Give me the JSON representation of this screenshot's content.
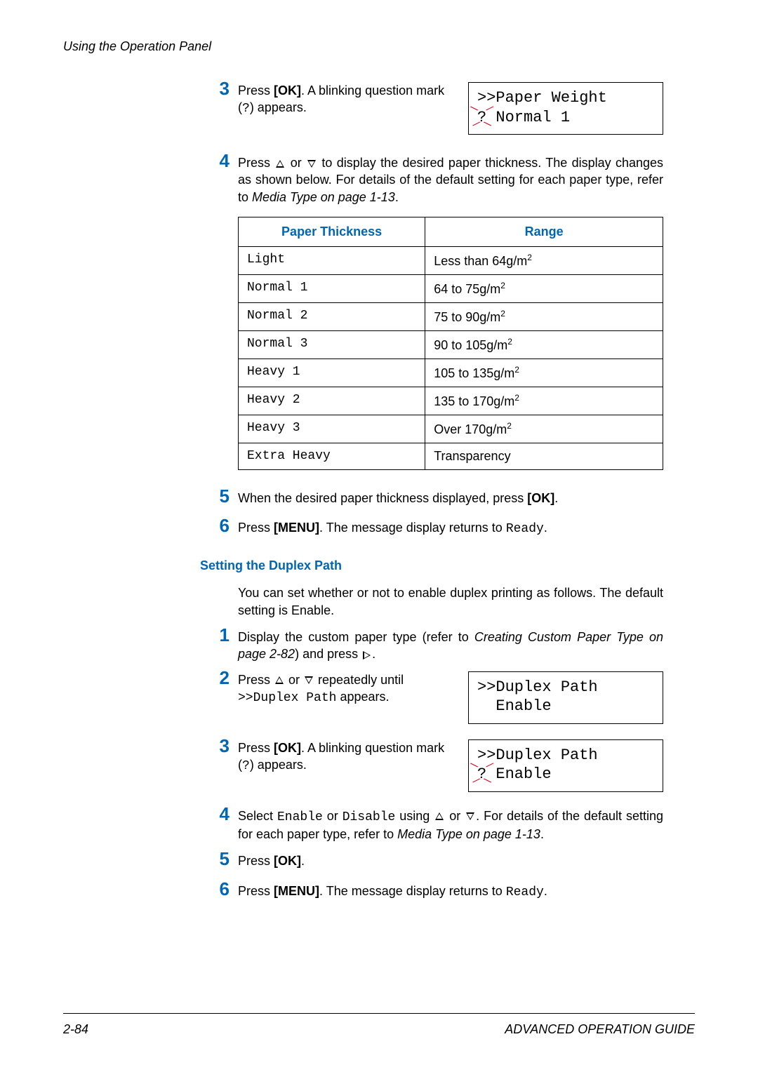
{
  "header": {
    "running_title": "Using the Operation Panel"
  },
  "section_a": {
    "step3": {
      "num": "3",
      "text_before": "Press ",
      "ok": "[OK]",
      "text_mid": ". A blinking question mark (",
      "qmark": "?",
      "text_after": ") appears."
    },
    "lcd1": {
      "line1": ">>Paper Weight",
      "line2_prefix": "?",
      "line2_rest": " Normal 1"
    },
    "step4": {
      "num": "4",
      "t1": "Press ",
      "t2": " or ",
      "t3": " to display the desired paper thickness. The display changes as shown below. For details of the default setting for each paper type, refer to ",
      "ref": "Media Type on page 1-13",
      "t4": "."
    },
    "table": {
      "h1": "Paper Thickness",
      "h2": "Range",
      "rows": [
        {
          "name": "Light",
          "range_pre": "Less than 64g/m",
          "sup": "2"
        },
        {
          "name": "Normal 1",
          "range_pre": "64 to 75g/m",
          "sup": "2"
        },
        {
          "name": "Normal 2",
          "range_pre": "75 to 90g/m",
          "sup": "2"
        },
        {
          "name": "Normal 3",
          "range_pre": "90 to 105g/m",
          "sup": "2"
        },
        {
          "name": "Heavy 1",
          "range_pre": "105 to 135g/m",
          "sup": "2"
        },
        {
          "name": "Heavy 2",
          "range_pre": "135 to 170g/m",
          "sup": "2"
        },
        {
          "name": "Heavy 3",
          "range_pre": "Over 170g/m",
          "sup": "2"
        },
        {
          "name": "Extra Heavy",
          "range_pre": "Transparency",
          "sup": ""
        }
      ]
    },
    "step5": {
      "num": "5",
      "t1": "When the desired paper thickness displayed, press ",
      "ok": "[OK]",
      "t2": "."
    },
    "step6": {
      "num": "6",
      "t1": "Press ",
      "menu": "[MENU]",
      "t2": ". The message display returns to ",
      "ready": "Ready",
      "t3": "."
    }
  },
  "section_b": {
    "title": "Setting the Duplex Path",
    "intro": "You can set whether or not to enable duplex printing as follows. The default setting is Enable.",
    "step1": {
      "num": "1",
      "t1": "Display the custom paper type (refer to ",
      "ref": "Creating Custom Paper Type on page 2-82",
      "t2": ") and press "
    },
    "step2": {
      "num": "2",
      "t1": "Press ",
      "t2": " or ",
      "t3": " repeatedly until ",
      "code": ">>Duplex Path",
      "t4": " appears."
    },
    "lcd2": {
      "line1": ">>Duplex Path",
      "line2": "  Enable"
    },
    "step3": {
      "num": "3",
      "text_before": "Press ",
      "ok": "[OK]",
      "text_mid": ". A blinking question mark (",
      "qmark": "?",
      "text_after": ") appears."
    },
    "lcd3": {
      "line1": ">>Duplex Path",
      "line2_prefix": "?",
      "line2_rest": " Enable"
    },
    "step4": {
      "num": "4",
      "t1": "Select ",
      "c1": "Enable",
      "t2": " or ",
      "c2": "Disable",
      "t3": " using ",
      "t4": " or ",
      "t5": ". For details of the default setting for each paper type, refer to ",
      "ref": "Media Type on page 1-13",
      "t6": "."
    },
    "step5": {
      "num": "5",
      "t1": "Press ",
      "ok": "[OK]",
      "t2": "."
    },
    "step6": {
      "num": "6",
      "t1": "Press ",
      "menu": "[MENU]",
      "t2": ". The message display returns to ",
      "ready": "Ready",
      "t3": "."
    }
  },
  "footer": {
    "page": "2-84",
    "book": "ADVANCED OPERATION GUIDE"
  }
}
